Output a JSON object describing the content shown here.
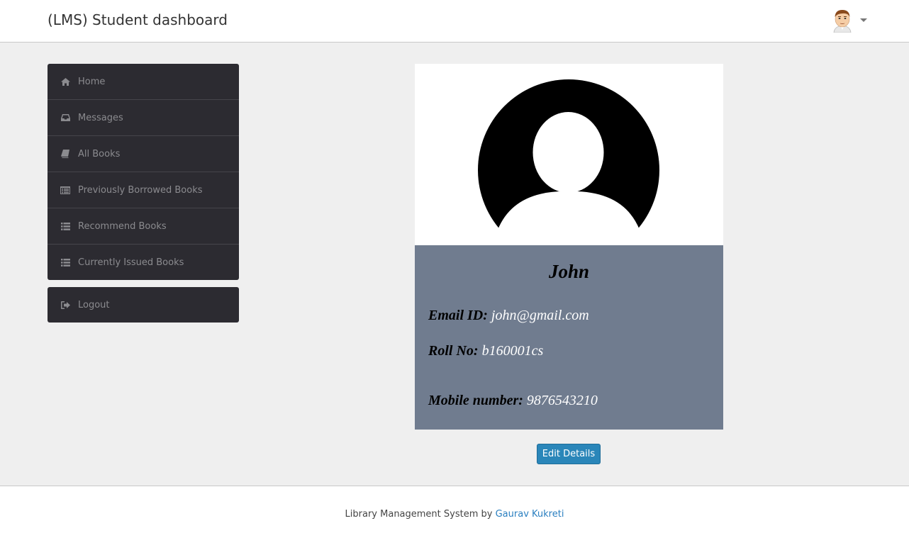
{
  "header": {
    "title": "(LMS) Student dashboard"
  },
  "sidebar": {
    "items": [
      {
        "label": "Home",
        "icon": "home-icon"
      },
      {
        "label": "Messages",
        "icon": "inbox-icon"
      },
      {
        "label": "All Books",
        "icon": "book-icon"
      },
      {
        "label": "Previously Borrowed Books",
        "icon": "list-alt-icon"
      },
      {
        "label": "Recommend Books",
        "icon": "list-icon"
      },
      {
        "label": "Currently Issued Books",
        "icon": "list-icon"
      }
    ],
    "logout_label": "Logout"
  },
  "profile": {
    "name": "John",
    "email_label": "Email ID:",
    "email": "john@gmail.com",
    "roll_label": "Roll No:",
    "roll": "b160001cs",
    "mobile_label": "Mobile number:",
    "mobile": "9876543210",
    "edit_label": "Edit Details"
  },
  "footer": {
    "text": "Library Management System by",
    "author": "Gaurav Kukreti"
  },
  "colors": {
    "sidebar_bg": "#2c2b31",
    "info_bg": "#707c8f",
    "button_bg": "#2a86b9",
    "link": "#2a7fc0"
  }
}
